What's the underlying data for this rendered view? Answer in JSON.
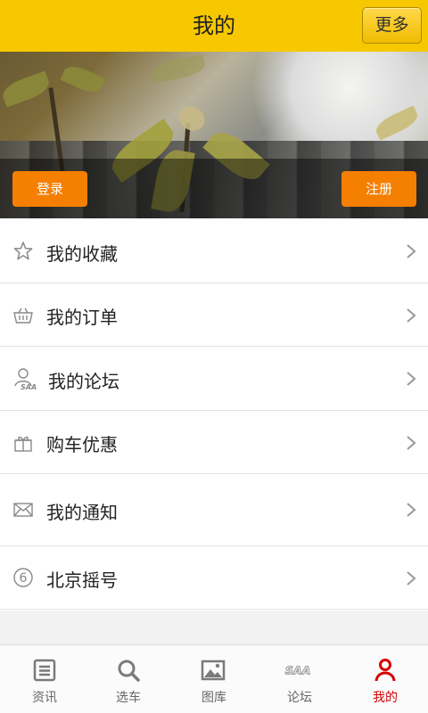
{
  "header": {
    "title": "我的",
    "more_label": "更多"
  },
  "banner": {
    "login_label": "登录",
    "register_label": "注册"
  },
  "menu": {
    "items": [
      {
        "label": "我的收藏",
        "icon": "star-icon"
      },
      {
        "label": "我的订单",
        "icon": "basket-icon"
      },
      {
        "label": "我的论坛",
        "icon": "saa-user-icon"
      },
      {
        "label": "购车优惠",
        "icon": "gift-icon"
      },
      {
        "label": "我的通知",
        "icon": "mail-icon"
      },
      {
        "label": "北京摇号",
        "icon": "number-six-icon"
      }
    ]
  },
  "tabbar": {
    "items": [
      {
        "label": "资讯",
        "icon": "news-icon"
      },
      {
        "label": "选车",
        "icon": "search-icon"
      },
      {
        "label": "图库",
        "icon": "image-icon"
      },
      {
        "label": "论坛",
        "icon": "saa-icon"
      },
      {
        "label": "我的",
        "icon": "person-icon"
      }
    ],
    "active": "我的"
  },
  "colors": {
    "header": "#f7c800",
    "button": "#f57f00",
    "active_tab": "#d60000"
  }
}
